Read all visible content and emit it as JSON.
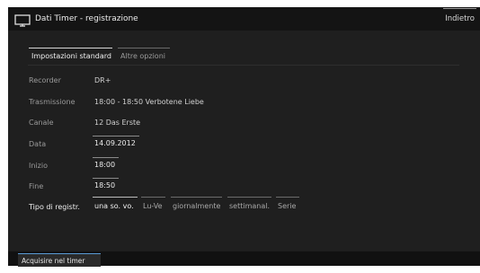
{
  "header": {
    "title": "Dati Timer - registrazione",
    "icon": "tv-icon",
    "back_label": "Indietro"
  },
  "tabs": [
    {
      "label": "Impostazioni standard",
      "active": true
    },
    {
      "label": "Altre opzioni",
      "active": false
    }
  ],
  "rows": {
    "recorder": {
      "label": "Recorder",
      "value": "DR+"
    },
    "broadcast": {
      "label": "Trasmissione",
      "value": "18:00 - 18:50 Verbotene Liebe"
    },
    "channel": {
      "label": "Canale",
      "value": "12 Das Erste"
    },
    "date": {
      "label": "Data",
      "value": "14.09.2012"
    },
    "start": {
      "label": "Inizio",
      "value": "18:00"
    },
    "end": {
      "label": "Fine",
      "value": "18:50"
    }
  },
  "recording_type": {
    "label": "Tipo di registr.",
    "selected": "una so. vo.",
    "options": [
      "una so. vo.",
      "Lu-Ve",
      "giornalmente",
      "settimanal.",
      "Serie"
    ]
  },
  "footer": {
    "acquire_label": "Acquisire nel timer"
  },
  "colors": {
    "background": "#1f1f1f",
    "header": "#141414",
    "accent": "#5a9bd5"
  }
}
